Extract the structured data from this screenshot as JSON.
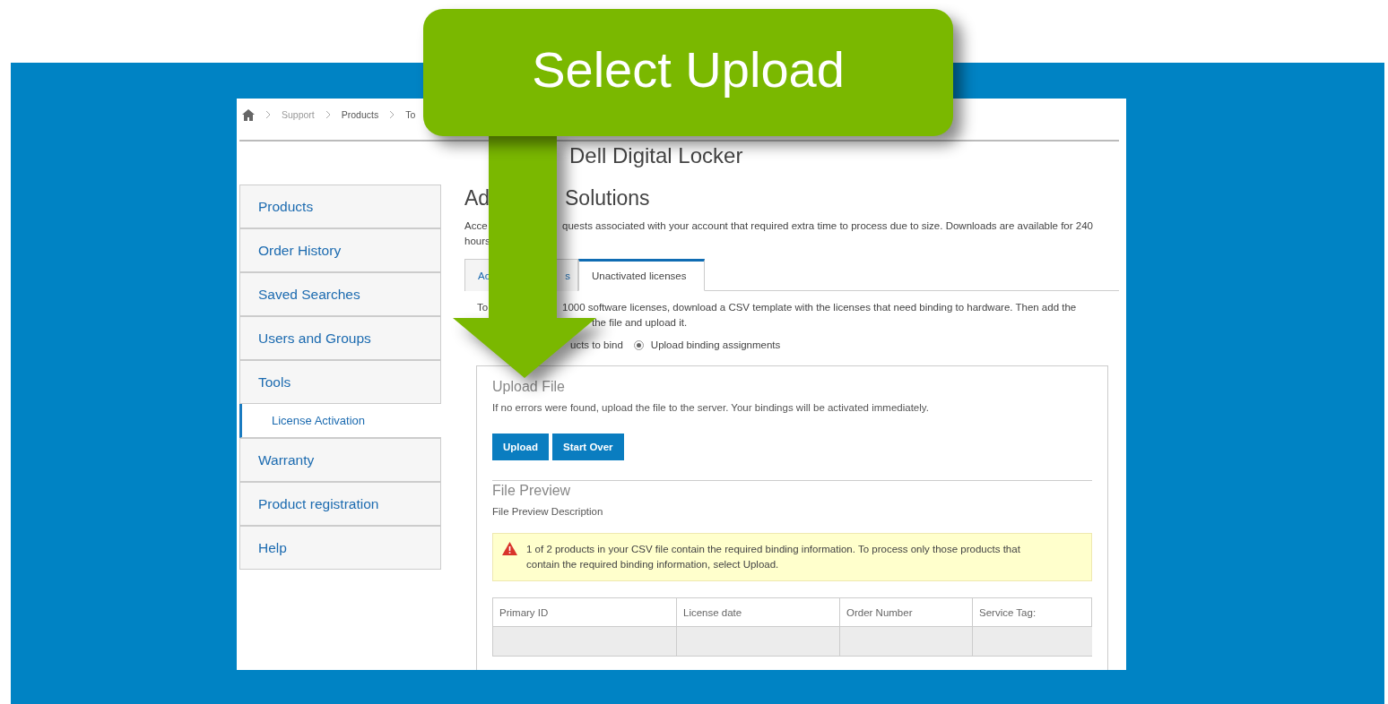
{
  "callout": {
    "text": "Select Upload"
  },
  "breadcrumb": [
    "Support",
    "Products",
    "To"
  ],
  "page_title": "Dell Digital Locker",
  "sidebar": {
    "items": [
      {
        "label": "Products",
        "kind": "item",
        "selected": false
      },
      {
        "label": "Order History",
        "kind": "item",
        "selected": false
      },
      {
        "label": "Saved Searches",
        "kind": "item",
        "selected": false
      },
      {
        "label": "Users and Groups",
        "kind": "item",
        "selected": false
      },
      {
        "label": "Tools",
        "kind": "item",
        "selected": false
      },
      {
        "label": "License Activation",
        "kind": "subitem",
        "selected": true
      },
      {
        "label": "Warranty",
        "kind": "item",
        "selected": false
      },
      {
        "label": "Product registration",
        "kind": "item",
        "selected": false
      },
      {
        "label": "Help",
        "kind": "item",
        "selected": false
      }
    ]
  },
  "main": {
    "heading_fragments": [
      "Ad",
      "Solutions"
    ],
    "description_fragments": [
      "Acce",
      "quests associated with your account that required extra time to process due to size. Downloads are available for 240",
      "hours"
    ],
    "tabs": [
      {
        "fragments": [
          "Ac",
          "s"
        ],
        "selected": false
      },
      {
        "fragments": [
          "Unactivated licenses"
        ],
        "selected": true
      }
    ],
    "instruction_fragments": [
      "To",
      "1000 software licenses, download a CSV template with the licenses that need binding to hardware. Then add the",
      "the file and upload it."
    ],
    "partial_option_label": "ucts to bind",
    "radios": [
      {
        "label": "Upload binding assignments",
        "selected": true
      }
    ],
    "upload_panel": {
      "title": "Upload File",
      "text": "If no errors were found, upload the file to the server. Your bindings will be activated immediately.",
      "buttons": [
        "Upload",
        "Start Over"
      ],
      "preview_title": "File Preview",
      "preview_description": "File Preview Description",
      "alert": "1 of 2 products in your CSV file contain the required binding information. To process only those products that contain the required binding information, select Upload.",
      "table": {
        "columns": [
          "Primary ID",
          "License date",
          "Order Number",
          "Service Tag:"
        ]
      }
    }
  }
}
